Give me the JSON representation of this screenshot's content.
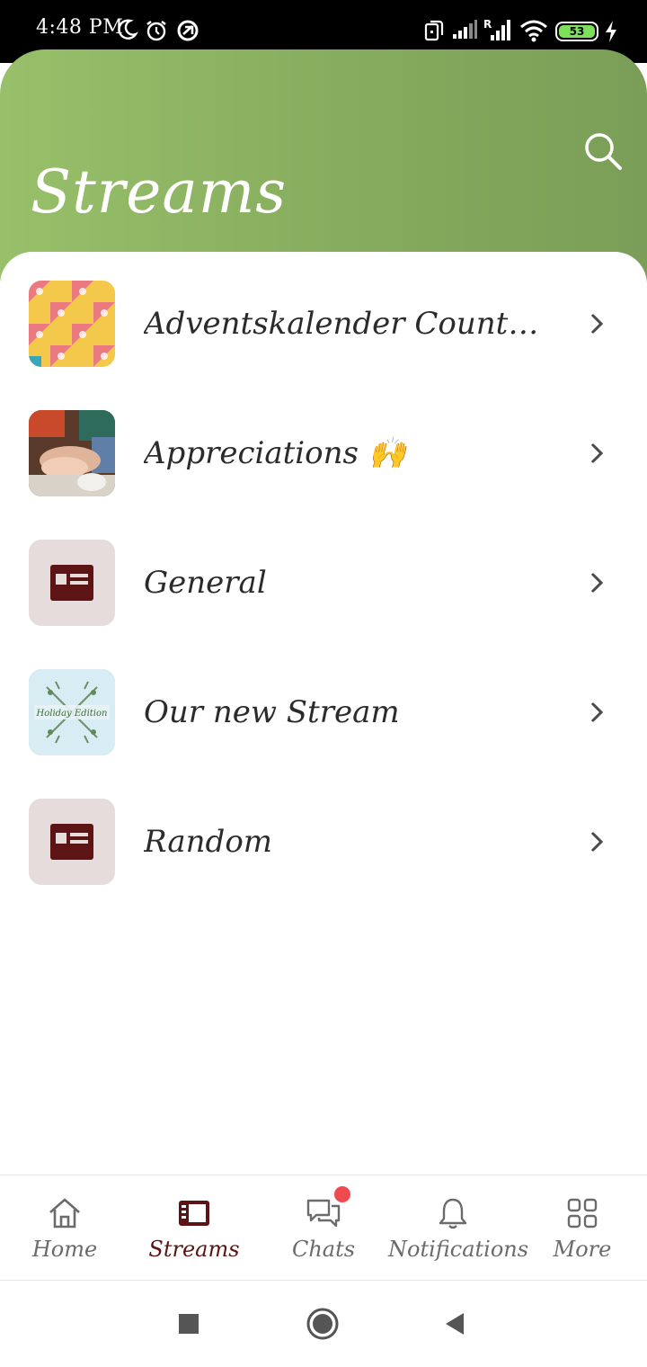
{
  "status_bar": {
    "time": "4:48 PM",
    "battery": "53",
    "icons": [
      "moon-icon",
      "alarm-icon",
      "data-saver-icon",
      "vibrate-icon",
      "signal-icon",
      "roaming-signal-icon",
      "wifi-icon",
      "battery-icon",
      "charging-icon"
    ]
  },
  "header": {
    "title": "Streams",
    "search_icon": "search-icon",
    "accent_gradient": [
      "#98c06a",
      "#7a9e57"
    ]
  },
  "streams": [
    {
      "name": "Adventskalender Countdo…",
      "thumb": "pattern-image"
    },
    {
      "name": "Appreciations 🙌",
      "thumb": "hands-photo"
    },
    {
      "name": "General",
      "thumb": "news-icon"
    },
    {
      "name": "Our new Stream",
      "thumb": "holiday-edition-image",
      "thumb_text": "Holiday Edition"
    },
    {
      "name": "Random",
      "thumb": "news-icon"
    }
  ],
  "bottom_nav": {
    "items": [
      {
        "label": "Home",
        "icon": "home-icon",
        "active": false
      },
      {
        "label": "Streams",
        "icon": "streams-icon",
        "active": true
      },
      {
        "label": "Chats",
        "icon": "chat-icon",
        "active": false,
        "badge": true
      },
      {
        "label": "Notifications",
        "icon": "bell-icon",
        "active": false
      },
      {
        "label": "More",
        "icon": "grid-icon",
        "active": false
      }
    ],
    "active_color": "#5c1414",
    "badge_color": "#ef4a4f"
  },
  "system_nav": [
    "recents-button",
    "home-button",
    "back-button"
  ]
}
